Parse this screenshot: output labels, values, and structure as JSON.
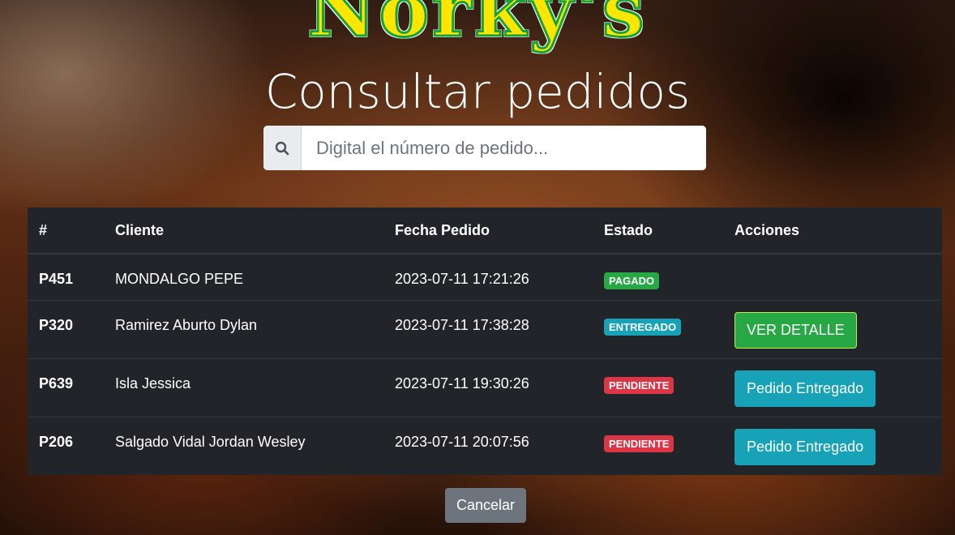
{
  "brand": {
    "logo_text": "Norky's",
    "logo_color": "#ffe600",
    "logo_outline_color": "#16a33a"
  },
  "page": {
    "title": "Consultar pedidos"
  },
  "search": {
    "placeholder": "Digital el número de pedido...",
    "value": "",
    "icon": "search-icon"
  },
  "table": {
    "columns": [
      "#",
      "Cliente",
      "Fecha Pedido",
      "Estado",
      "Acciones"
    ],
    "rows": [
      {
        "id": "P451",
        "client": "MONDALGO PEPE",
        "date": "2023-07-11 17:21:26",
        "status": "PAGADO",
        "status_color": "#28a745",
        "action": ""
      },
      {
        "id": "P320",
        "client": "Ramirez Aburto Dylan",
        "date": "2023-07-11 17:38:28",
        "status": "ENTREGADO",
        "status_color": "#17a2b8",
        "action": "VER DETALLE"
      },
      {
        "id": "P639",
        "client": "Isla Jessica",
        "date": "2023-07-11 19:30:26",
        "status": "PENDIENTE",
        "status_color": "#dc3545",
        "action": "Pedido Entregado"
      },
      {
        "id": "P206",
        "client": "Salgado Vidal Jordan Wesley",
        "date": "2023-07-11 20:07:56",
        "status": "PENDIENTE",
        "status_color": "#dc3545",
        "action": "Pedido Entregado"
      }
    ]
  },
  "footer": {
    "cancel_label": "Cancelar"
  },
  "colors": {
    "table_bg": "#212529",
    "btn_success": "#28a745",
    "btn_info": "#17a2b8",
    "btn_secondary": "#6c757d"
  }
}
